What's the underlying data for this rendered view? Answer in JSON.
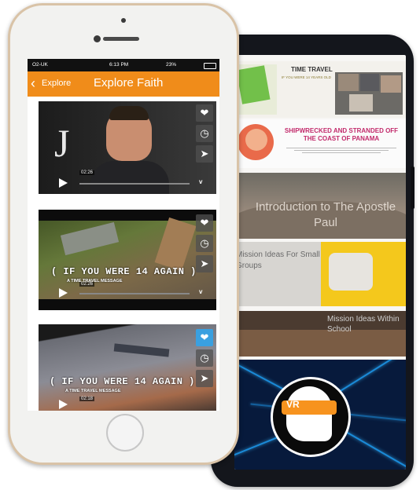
{
  "front_phone": {
    "status_bar": {
      "carrier": "O2-UK",
      "time": "6:13 PM",
      "battery": "23%"
    },
    "nav": {
      "back_label": "Explore",
      "title": "Explore Faith"
    },
    "videos": [
      {
        "duration": "02:26",
        "overlay_title": "",
        "overlay_sub": "",
        "letter": "J",
        "favorited": false
      },
      {
        "duration": "02:26",
        "overlay_title": "( IF YOU WERE 14 AGAIN )",
        "overlay_sub": "A TIME TRAVEL MESSAGE",
        "letter": "",
        "favorited": false
      },
      {
        "duration": "02:18",
        "overlay_title": "( IF YOU WERE 14 AGAIN )",
        "overlay_sub": "A TIME TRAVEL MESSAGE",
        "letter": "",
        "favorited": true
      }
    ],
    "icons": {
      "favorite": "heart-icon",
      "later": "clock-icon",
      "share": "send-icon",
      "play": "play-icon",
      "vimeo": "vimeo-logo-icon"
    }
  },
  "back_phone": {
    "tiles": {
      "time_travel": {
        "title": "TIME TRAVEL",
        "subtitle": "IF YOU WERE 14 YEARS OLD"
      },
      "shipwrecked": {
        "title": "SHIPWRECKED AND STRANDED OFF THE COAST OF PANAMA"
      },
      "apostle_paul": {
        "title": "Introduction to The Apostle Paul"
      },
      "mission_small": {
        "title": "Mission Ideas For Small Groups"
      },
      "mission_school": {
        "title": "Mission Ideas Within School"
      },
      "vr": {
        "label": "VR"
      }
    }
  },
  "colors": {
    "nav_orange": "#f08c1a",
    "fav_blue": "#3aa0e0",
    "ship_pink": "#c22a6b",
    "vr_orange": "#f7931e"
  }
}
